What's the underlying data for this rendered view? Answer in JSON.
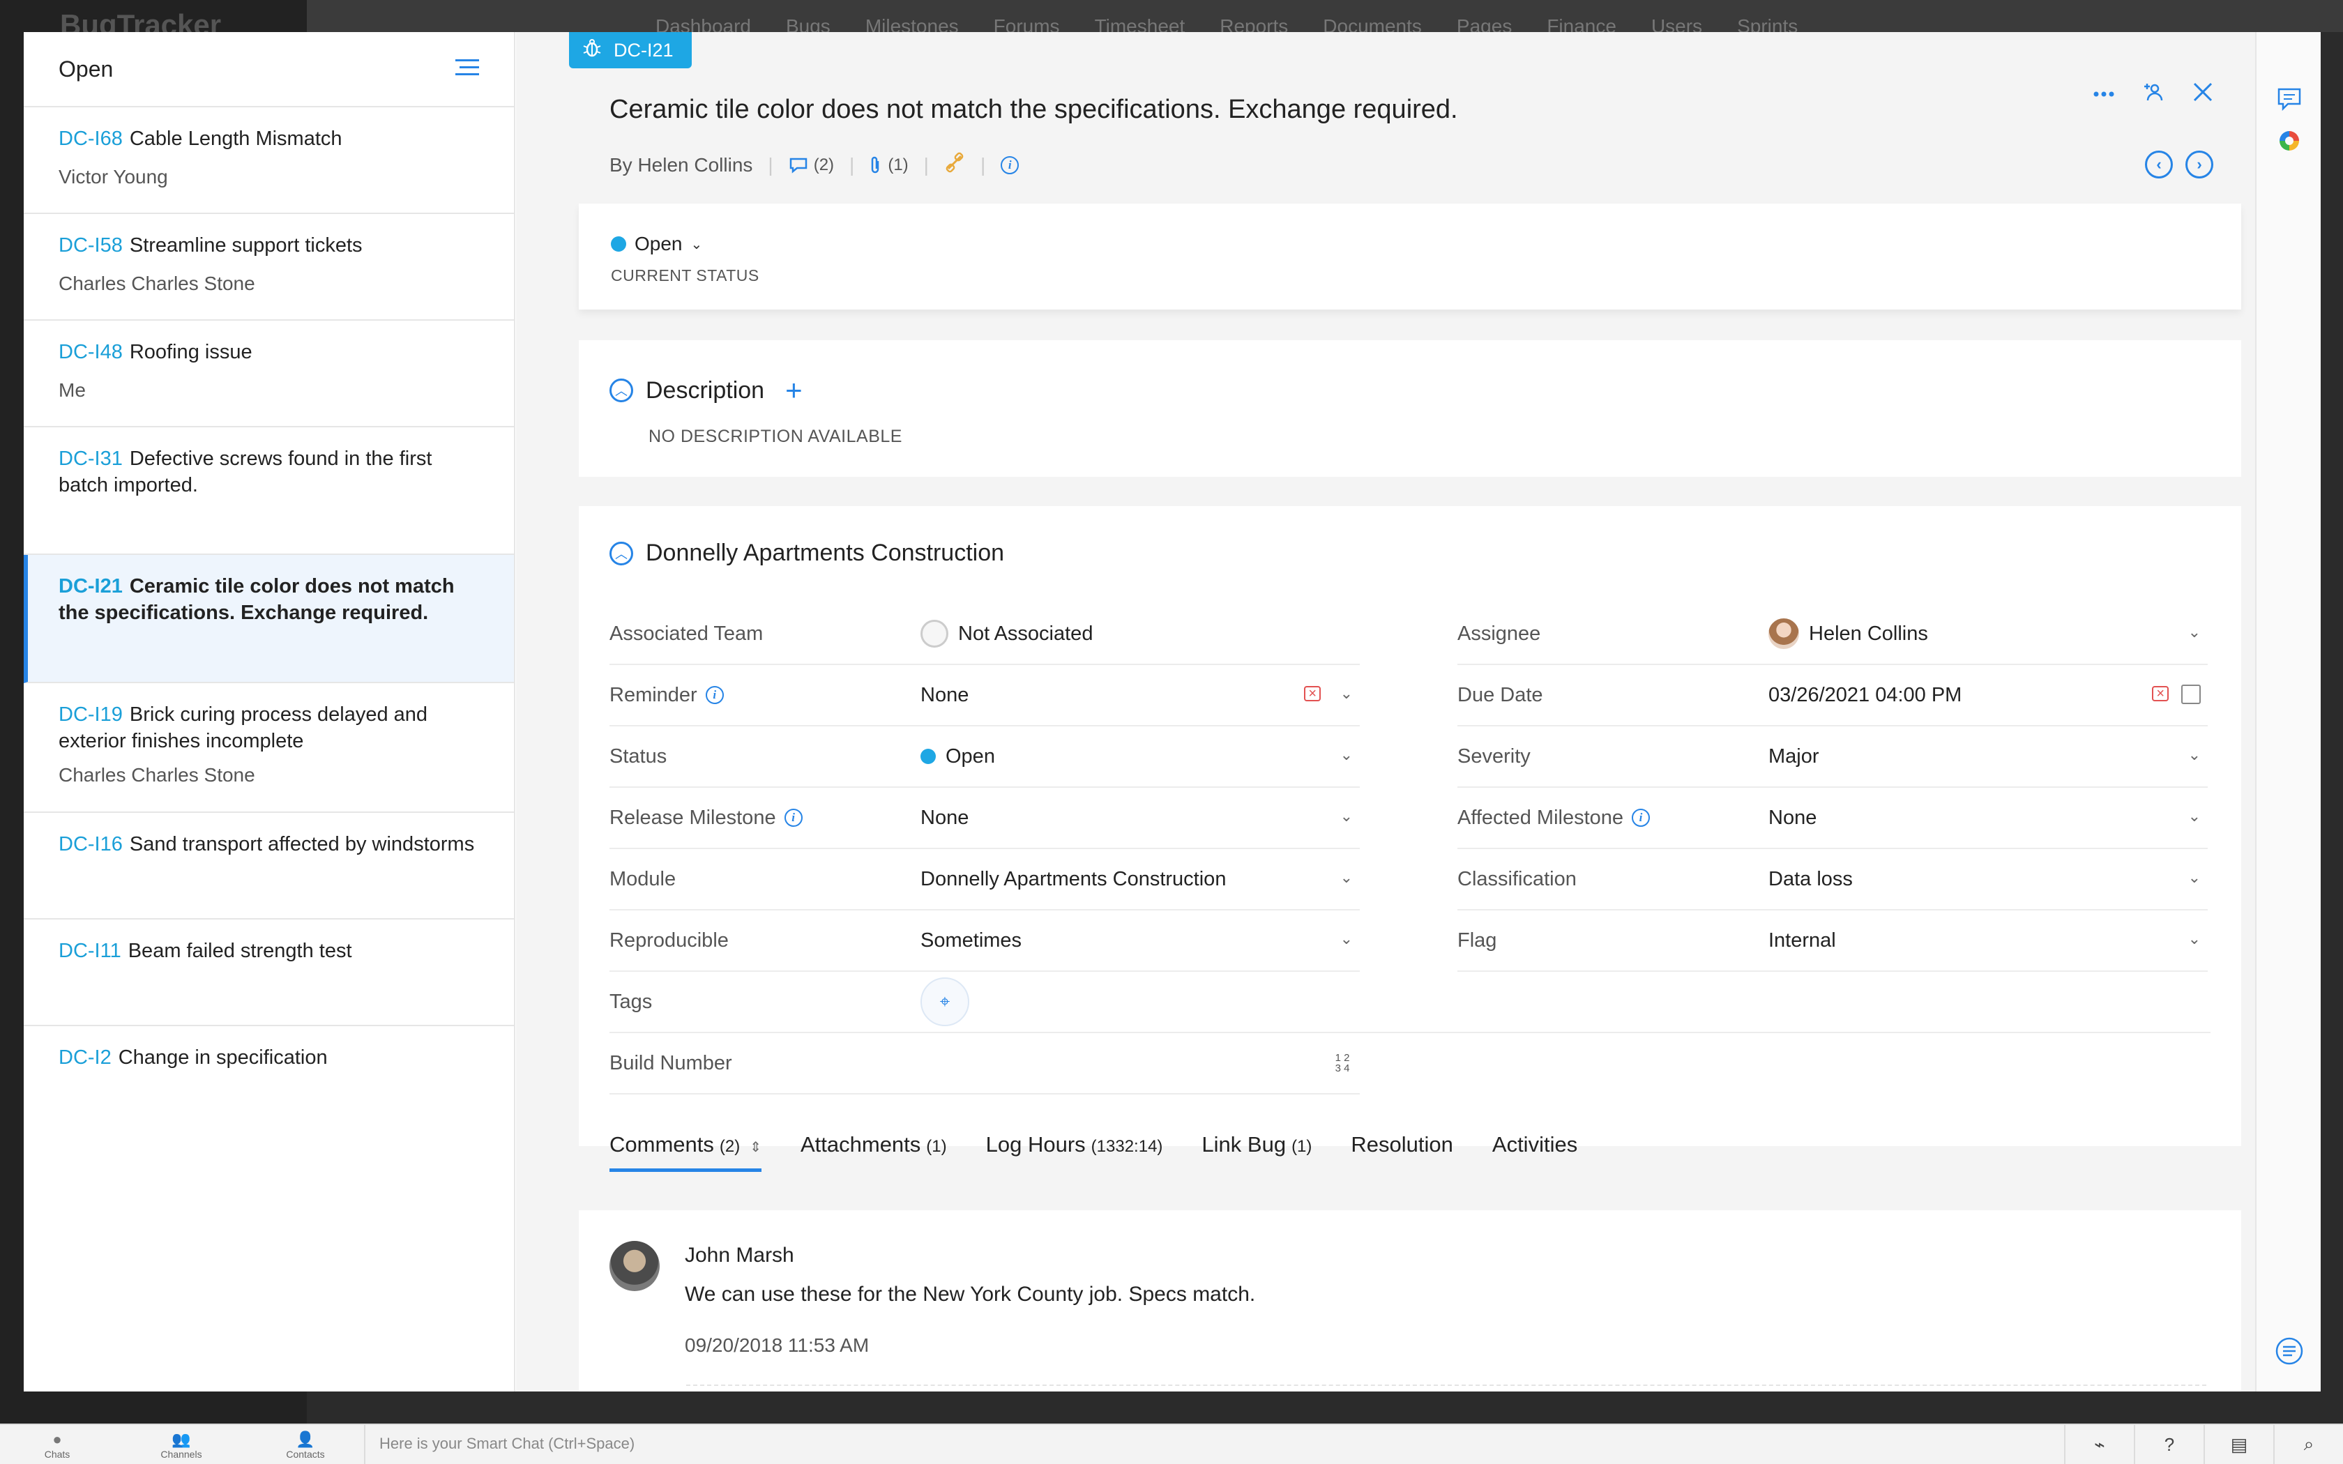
{
  "background": {
    "logo": "BugTracker",
    "nav": [
      "Dashboard",
      "Bugs",
      "Milestones",
      "Forums",
      "Timesheet",
      "Reports",
      "Documents",
      "Pages",
      "Finance",
      "Users",
      "Sprints"
    ]
  },
  "list": {
    "title": "Open",
    "items": [
      {
        "key": "DC-I68",
        "title": "Cable Length Mismatch",
        "sub": "Victor Young"
      },
      {
        "key": "DC-I58",
        "title": "Streamline support tickets",
        "sub": "Charles Charles Stone"
      },
      {
        "key": "DC-I48",
        "title": "Roofing issue",
        "sub": "Me"
      },
      {
        "key": "DC-I31",
        "title": "Defective screws found in the first batch imported.",
        "sub": ""
      },
      {
        "key": "DC-I21",
        "title": "Ceramic tile color does not match the specifications. Exchange required.",
        "sub": "",
        "active": true
      },
      {
        "key": "DC-I19",
        "title": "Brick curing process delayed and exterior finishes incomplete",
        "sub": "Charles Charles Stone"
      },
      {
        "key": "DC-I16",
        "title": "Sand transport affected by windstorms",
        "sub": ""
      },
      {
        "key": "DC-I11",
        "title": "Beam failed strength test",
        "sub": ""
      },
      {
        "key": "DC-I2",
        "title": "Change in specification",
        "sub": ""
      }
    ]
  },
  "detail": {
    "badge": "DC-I21",
    "title": "Ceramic tile color does not match the specifications. Exchange required.",
    "by": "By Helen Collins",
    "comments_count": "(2)",
    "attachments_count": "(1)",
    "status": "Open",
    "status_label": "CURRENT STATUS",
    "description_title": "Description",
    "no_description": "NO DESCRIPTION AVAILABLE",
    "project_title": "Donnelly Apartments Construction"
  },
  "fields": {
    "associated_team": {
      "label": "Associated Team",
      "value": "Not Associated"
    },
    "reminder": {
      "label": "Reminder",
      "value": "None"
    },
    "status": {
      "label": "Status",
      "value": "Open"
    },
    "release_milestone": {
      "label": "Release Milestone",
      "value": "None"
    },
    "module": {
      "label": "Module",
      "value": "Donnelly Apartments Construction"
    },
    "reproducible": {
      "label": "Reproducible",
      "value": "Sometimes"
    },
    "tags": {
      "label": "Tags"
    },
    "build_number": {
      "label": "Build Number",
      "icon_text": "1 2 3 4"
    },
    "assignee": {
      "label": "Assignee",
      "value": "Helen Collins"
    },
    "due_date": {
      "label": "Due Date",
      "value": "03/26/2021 04:00 PM"
    },
    "severity": {
      "label": "Severity",
      "value": "Major"
    },
    "affected_milestone": {
      "label": "Affected Milestone",
      "value": "None"
    },
    "classification": {
      "label": "Classification",
      "value": "Data loss"
    },
    "flag": {
      "label": "Flag",
      "value": "Internal"
    }
  },
  "tabs": [
    {
      "label": "Comments",
      "count": "(2)"
    },
    {
      "label": "Attachments",
      "count": "(1)"
    },
    {
      "label": "Log Hours",
      "count": "(1332:14)"
    },
    {
      "label": "Link Bug",
      "count": "(1)"
    },
    {
      "label": "Resolution",
      "count": ""
    },
    {
      "label": "Activities",
      "count": ""
    }
  ],
  "comment": {
    "author": "John Marsh",
    "text": "We can use these for the New York County job. Specs match.",
    "date": "09/20/2018 11:53 AM"
  },
  "taskbar": {
    "chats": "Chats",
    "channels": "Channels",
    "contacts": "Contacts",
    "smart_chat_placeholder": "Here is your Smart Chat (Ctrl+Space)"
  },
  "colors": {
    "accent": "#2684e6",
    "badge": "#1ea7e4",
    "status_open": "#1ea7e4",
    "clear": "#e25151"
  }
}
